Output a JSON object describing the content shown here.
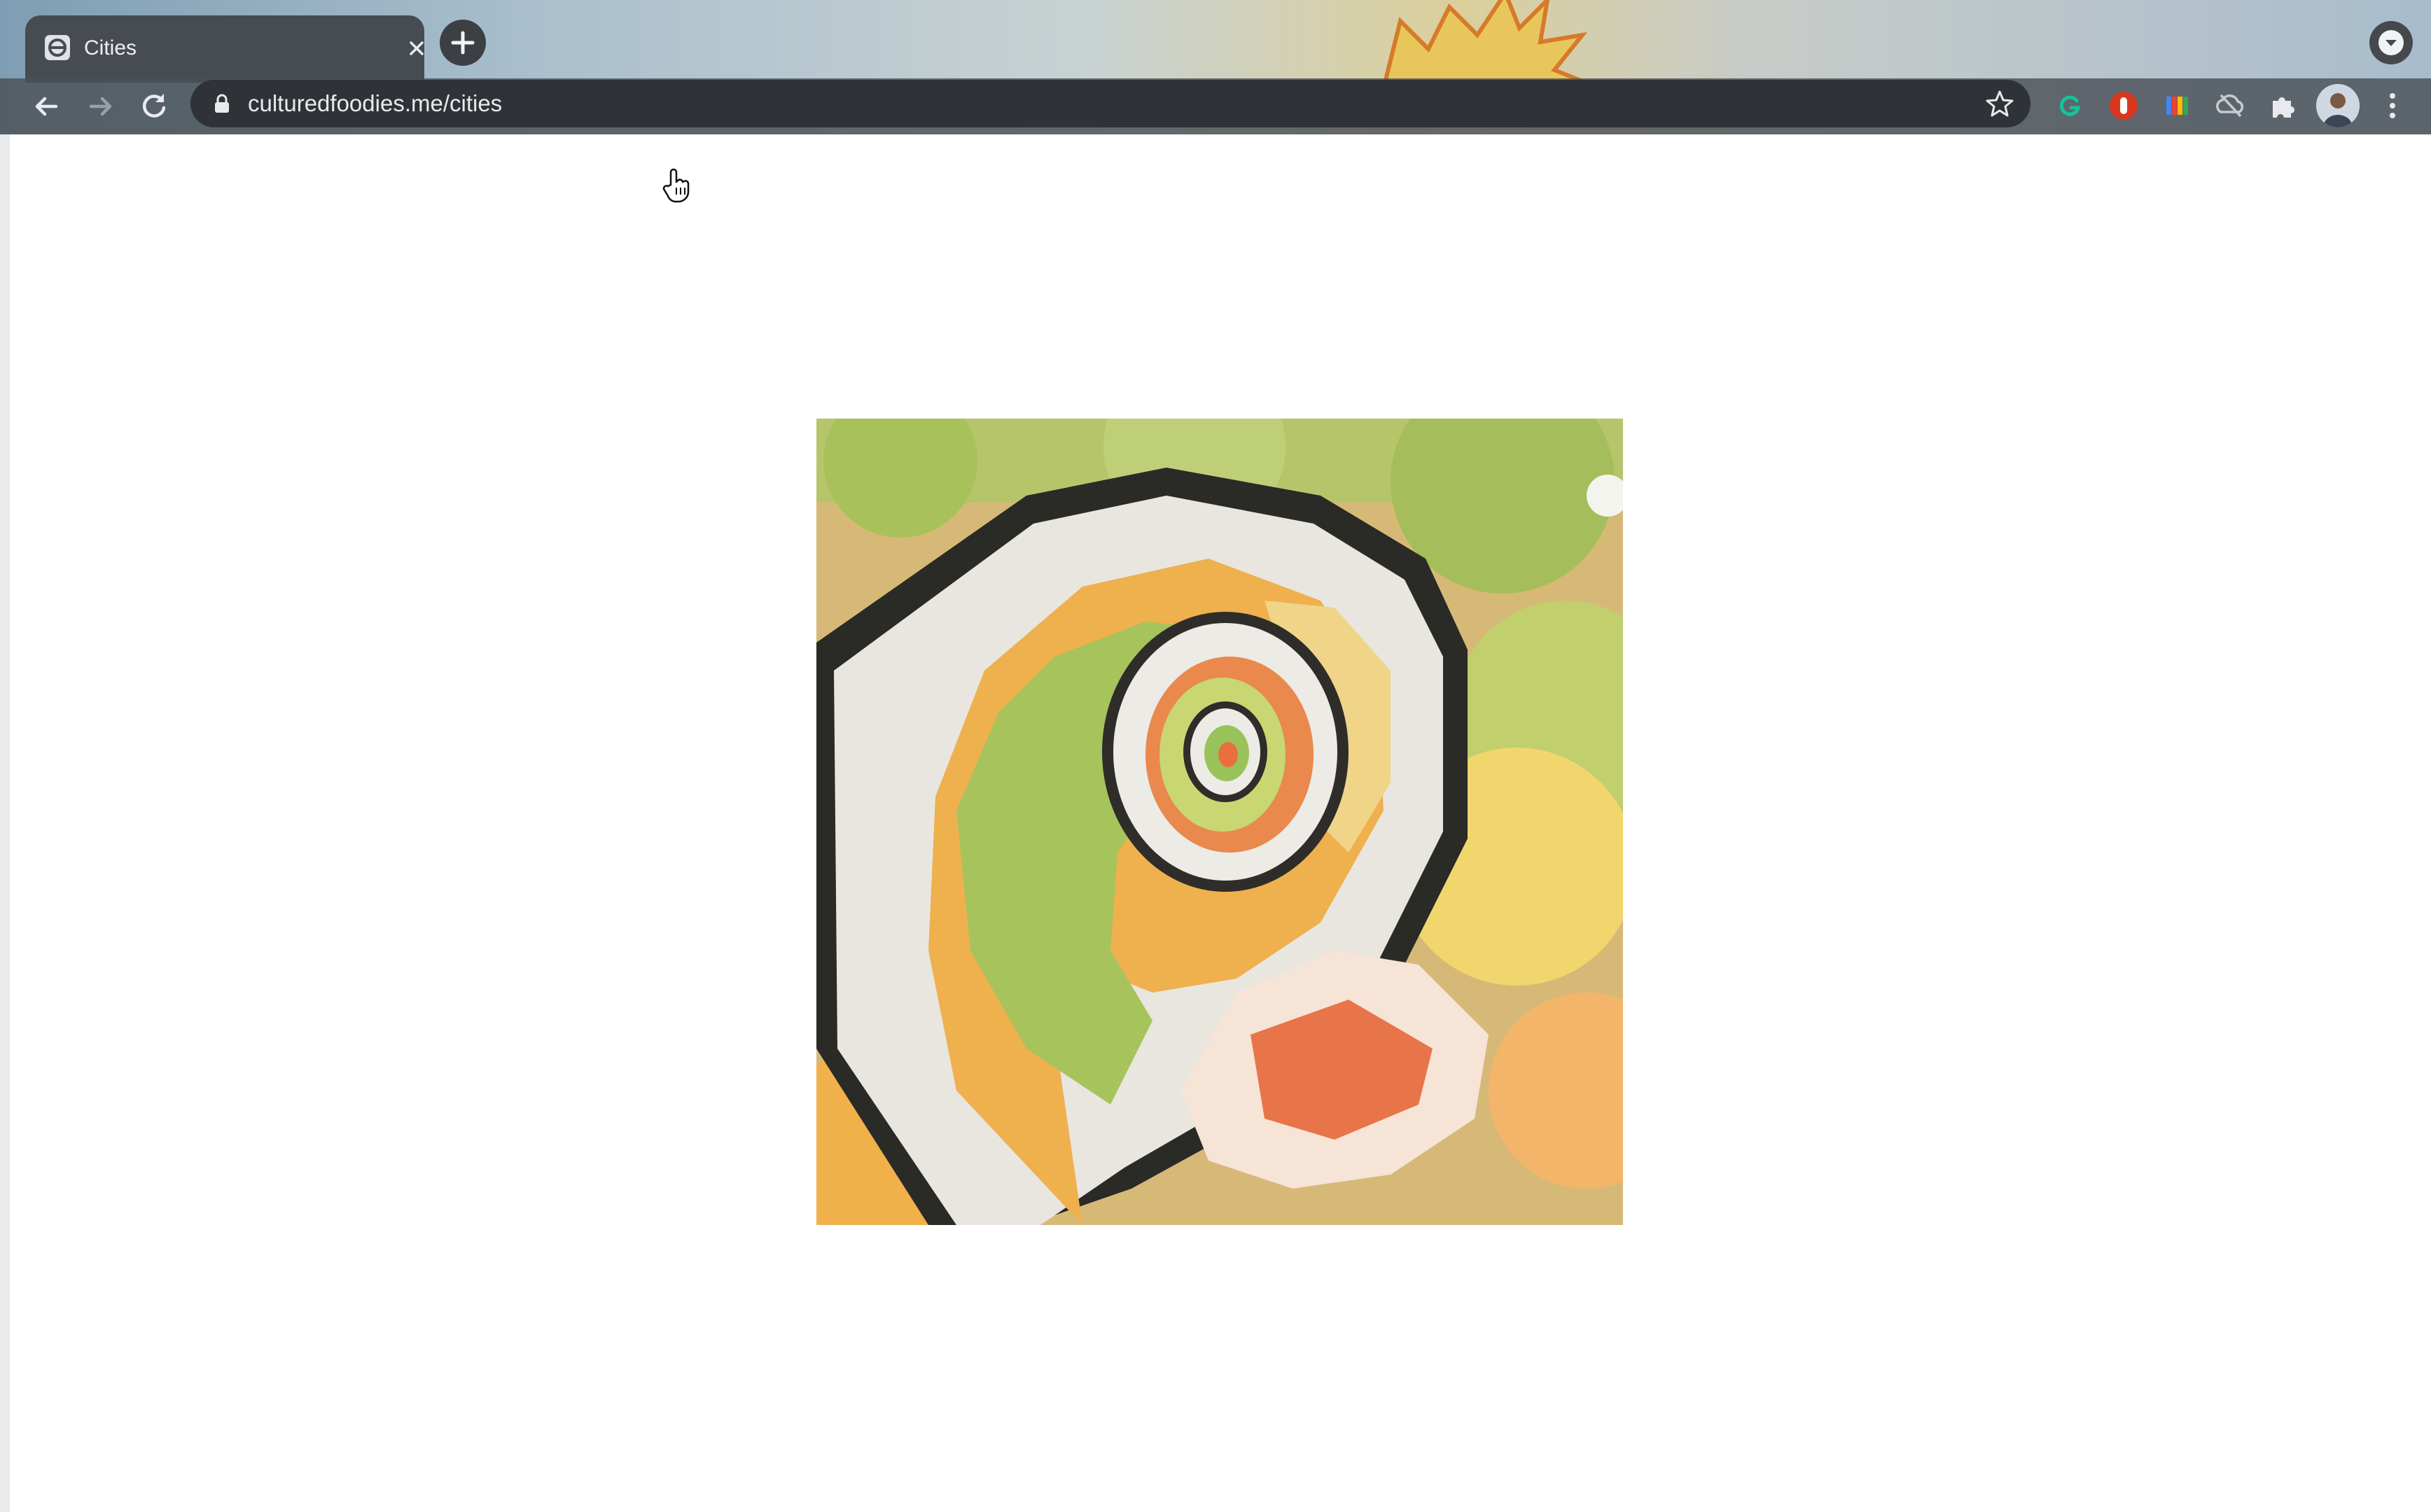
{
  "browser": {
    "tab": {
      "title": "Cities",
      "favicon": "cultured-foodies-favicon"
    },
    "new_tab_icon": "plus-icon",
    "nav": {
      "back_icon": "arrow-left-icon",
      "forward_icon": "arrow-right-icon",
      "reload_icon": "reload-icon"
    },
    "address": {
      "lock_icon": "lock-icon",
      "url": "culturedfoodies.me/cities",
      "bookmark_icon": "star-icon"
    },
    "extensions": [
      "grammarly-icon",
      "red-shield-extension-icon",
      "color-bars-extension-icon",
      "cloud-extension-icon",
      "puzzle-piece-icon"
    ],
    "profile": "avatar",
    "menu_icon": "kebab-menu-icon"
  },
  "page": {
    "hero_image": "sushi-roll-spiral-image"
  },
  "colors": {
    "tab_bg": "#474c52",
    "omnibox_bg": "#2f3338",
    "page_bg": "#ffffff"
  }
}
